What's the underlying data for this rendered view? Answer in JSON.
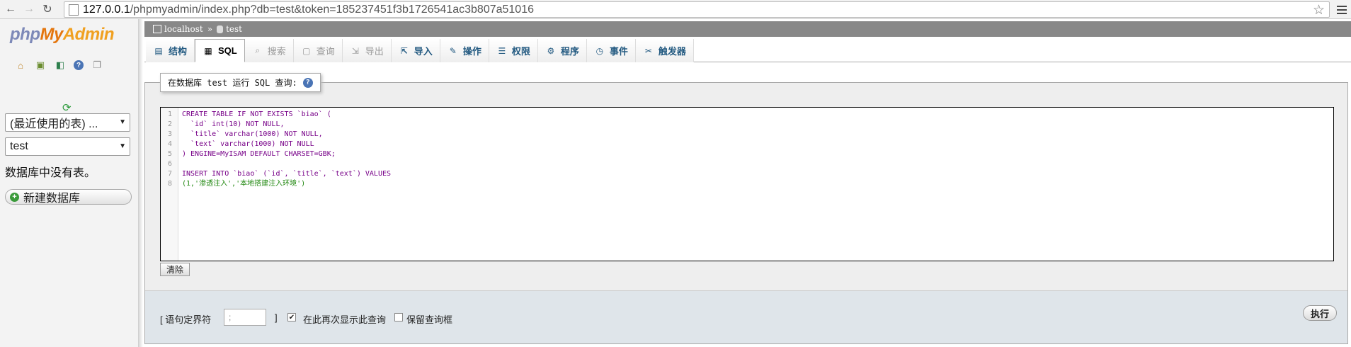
{
  "browser": {
    "url_host": "127.0.0.1",
    "url_path": "/phpmyadmin/index.php?db=test&token=185237451f3b1726541ac3b807a51016"
  },
  "logo": {
    "php": "php",
    "my": "My",
    "admin": "Admin"
  },
  "left": {
    "recent_select": "(最近使用的表) ...",
    "db_select": "test",
    "no_tables": "数据库中没有表。",
    "new_db": "新建数据库"
  },
  "breadcrumb": {
    "server": "localhost",
    "separator": "»",
    "db": "test"
  },
  "tabs": [
    {
      "label": "结构",
      "icon": "structure-icon"
    },
    {
      "label": "SQL",
      "icon": "sql-icon"
    },
    {
      "label": "搜索",
      "icon": "search-icon"
    },
    {
      "label": "查询",
      "icon": "query-icon"
    },
    {
      "label": "导出",
      "icon": "export-icon"
    },
    {
      "label": "导入",
      "icon": "import-icon"
    },
    {
      "label": "操作",
      "icon": "wrench-icon"
    },
    {
      "label": "权限",
      "icon": "privileges-icon"
    },
    {
      "label": "程序",
      "icon": "routines-icon"
    },
    {
      "label": "事件",
      "icon": "events-icon"
    },
    {
      "label": "触发器",
      "icon": "triggers-icon"
    }
  ],
  "query": {
    "legend": "在数据库 test 运行 SQL 查询:",
    "line_numbers": [
      "1",
      "2",
      "3",
      "4",
      "5",
      "6",
      "7",
      "8"
    ],
    "lines": [
      "CREATE TABLE IF NOT EXISTS `biao` (",
      "  `id` int(10) NOT NULL,",
      "  `title` varchar(1000) NOT NULL,",
      "  `text` varchar(1000) NOT NULL",
      ") ENGINE=MyISAM DEFAULT CHARSET=GBK;",
      "",
      "INSERT INTO `biao` (`id`, `title`, `text`) VALUES",
      "(1,'渗透注入','本地搭建注入环境')"
    ],
    "clear_button": "清除"
  },
  "footer": {
    "delimiter_label": "[ 语句定界符",
    "delimiter_value": ";",
    "delimiter_close": "]",
    "show_again_label": "在此再次显示此查询",
    "show_again_checked": "✔",
    "keep_box_label": "保留查询框",
    "go_button": "执行"
  },
  "colors": {
    "logo_php": "#7d89b8",
    "logo_my": "#e4760e",
    "crumb_bg": "#888888",
    "link": "#235a81"
  }
}
